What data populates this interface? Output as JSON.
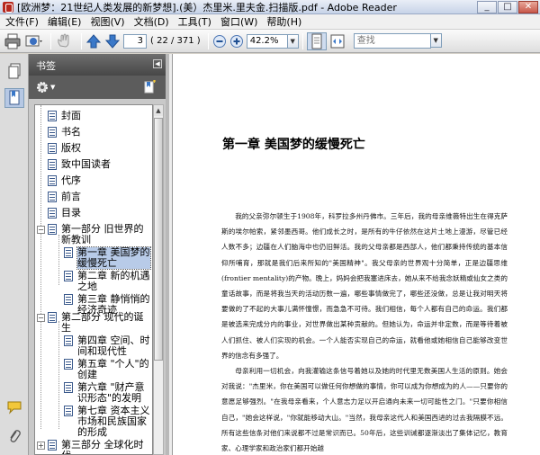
{
  "window": {
    "title": "[欧洲梦：21世纪人类发展的新梦想].(美）杰里米.里夫金.扫描版.pdf - Adobe Reader",
    "minimize": "_",
    "maximize": "□",
    "close": "✕"
  },
  "menu": [
    "文件(F)",
    "编辑(E)",
    "视图(V)",
    "文档(D)",
    "工具(T)",
    "窗口(W)",
    "帮助(H)"
  ],
  "toolbar": {
    "page_current": "3",
    "page_count": "( 22 / 371 )",
    "zoom": "42.2%",
    "search_placeholder": "查找",
    "icons": [
      "print-icon",
      "email-icon",
      "hand-icon",
      "arrow-up-icon",
      "arrow-down-icon",
      "zoom-out-icon",
      "zoom-in-icon",
      "fit-page-icon",
      "fit-width-icon"
    ]
  },
  "bookmarks": {
    "header": "书签",
    "items": [
      {
        "label": "封面",
        "level": 1
      },
      {
        "label": "书名",
        "level": 1
      },
      {
        "label": "版权",
        "level": 1
      },
      {
        "label": "致中国读者",
        "level": 1
      },
      {
        "label": "代序",
        "level": 1
      },
      {
        "label": "前言",
        "level": 1
      },
      {
        "label": "目录",
        "level": 1
      },
      {
        "label": "第一部分 旧世界的新教训",
        "level": 1,
        "expander": "−"
      },
      {
        "label": "第一章 美国梦的缓慢死亡",
        "level": 2,
        "selected": true
      },
      {
        "label": "第二章 新的机遇之地",
        "level": 2
      },
      {
        "label": "第三章 静悄悄的经济奇迹",
        "level": 2
      },
      {
        "label": "第二部分 现代的诞生",
        "level": 1,
        "expander": "−"
      },
      {
        "label": "第四章 空间、时间和现代性",
        "level": 2
      },
      {
        "label": "第五章 \"个人\"的创建",
        "level": 2
      },
      {
        "label": "第六章 \"财产意识形态\"的发明",
        "level": 2
      },
      {
        "label": "第七章 资本主义市场和民族国家的形成",
        "level": 2
      },
      {
        "label": "第三部分 全球化时代",
        "level": 1,
        "expander": "+"
      }
    ]
  },
  "document": {
    "chapter_title": "第一章  美国梦的缓慢死亡",
    "paragraphs": [
      "我的父亲弥尔顿生于1908年，科罗拉多州丹佛市。三年后，我的母亲维薇特出生在得克萨斯的埃尔帕索，紧邻墨西哥。他们成长之时，是所有的牛仔依然在这片土地上漫游，尽管已经人数不多；边疆在人们脑海中也仍旧鲜活。我的父母亲都是西部人，他们都秉持传统的基本信仰所哺育，那就是我们后来所知的\"美国精神\"。我父母亲的世界观十分简单，正是边疆思维(frontier mentality)的产物。晚上，妈妈会把我塞进床去，她从来不给我念妖精或仙女之类的童话故事，而是将我当天的活动历数一遍，哪些事情做完了，哪些还没做，总是让我对明天将要做的了不起的大事儿满怀憧憬，而急急不可待。我们相信，每个人都有自己的命运。我们都是被选来完成分内的事业，对世界做出某种贡献的。但她认为，命运并非定数，而是等待着被人们抓住、被人们实现的机会。一个人能否实现自己的命运，就看他或她相信自己能够改变世界的信念有多强了。",
      "母亲利用一切机会，向我灌输这条信号着她以及她的时代里无数美国人生活的原则。她会对我说：\"杰里米，你在美国可以做任何你想做的事情，你可以成为你想成为的人——只要你的意愿足够强烈。\"在我母亲看来，个人意志力足以开启通向未来一切可能性之门。\"只要你相信自己，\"她会这样说，\"你就能移动大山。\"当然，我母亲这代人和美国西进的过去我隔膜不远。所有这些信条对他们来说都不过是常识而已。50年后，这些训诫都逐渐淡出了集体记忆，教育家、心理学家和政治家们都开始越"
    ]
  }
}
